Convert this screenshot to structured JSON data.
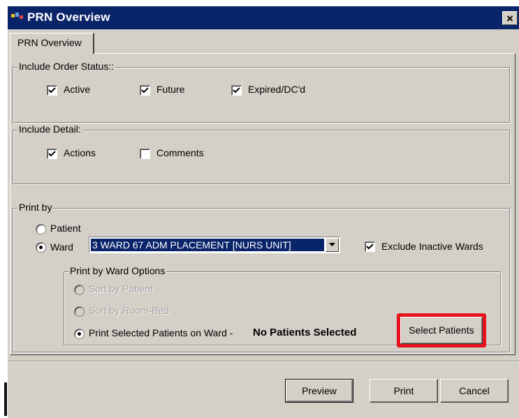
{
  "window": {
    "title": "PRN Overview",
    "close_glyph": "×"
  },
  "tab": {
    "label": "PRN Overview"
  },
  "order_status": {
    "legend": "Include Order Status::",
    "options": [
      {
        "label": "Active",
        "checked": true
      },
      {
        "label": "Future",
        "checked": true
      },
      {
        "label": "Expired/DC'd",
        "checked": true
      }
    ]
  },
  "detail": {
    "legend": "Include Detail:",
    "options": [
      {
        "label": "Actions",
        "checked": true
      },
      {
        "label": "Comments",
        "checked": false
      }
    ]
  },
  "print_by": {
    "legend": "Print by",
    "patient_label": "Patient",
    "ward_label": "Ward",
    "selected": "Ward",
    "ward_value": "3 WARD 67 ADM PLACEMENT [NURS UNIT]",
    "exclude_inactive_label": "Exclude Inactive Wards",
    "exclude_inactive_checked": true
  },
  "ward_options": {
    "legend": "Print by Ward Options",
    "sort_by_patient": "Sort by Patient",
    "sort_by_room": "Sort by Room-Bed",
    "print_selected_label": "Print Selected Patients on Ward - ",
    "selection_status": "No Patients Selected",
    "select_patients_button": "Select Patients"
  },
  "footer": {
    "preview": "Preview",
    "print": "Print",
    "cancel": "Cancel"
  },
  "colors": {
    "titlebar": "#0a246a",
    "face": "#d4d0c8",
    "highlight_box": "#e8141c"
  }
}
